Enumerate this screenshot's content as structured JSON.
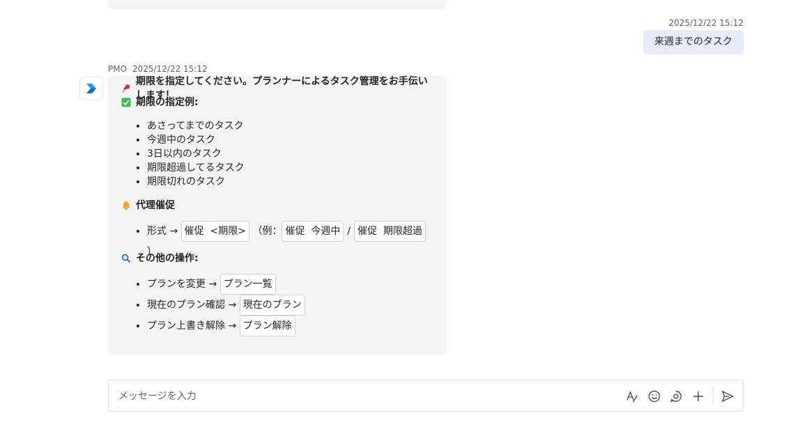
{
  "outgoing": {
    "timestamp": "2025/12/22 15:12",
    "text": "来週までのタスク"
  },
  "bot": {
    "sender": "PMO",
    "timestamp": "2025/12/22 15:12",
    "avatar_icon": "planner-logo-icon",
    "intro": "期限を指定してください。プランナーによるタスク管理をお手伝いします！",
    "intro_icon": "pushpin-icon",
    "examples_heading": "期限の指定例:",
    "examples_icon": "check-box-icon",
    "examples": [
      "あさってまでのタスク",
      "今週中のタスク",
      "3日以内のタスク",
      "期限超過してるタスク",
      "期限切れのタスク"
    ],
    "proxy_heading": "代理催促",
    "proxy_icon": "bell-icon",
    "proxy": {
      "lead": "形式 →",
      "format_chip": "催促  <期限>",
      "example_open": "（例：",
      "example_chip_1": "催促  今週中",
      "slash": "/",
      "example_chip_2": "催促  期限超過",
      "example_close": "）"
    },
    "other_heading": "その他の操作:",
    "other_icon": "magnifier-icon",
    "other": [
      {
        "lead": "プランを変更 →",
        "chip": "プラン一覧"
      },
      {
        "lead": "現在のプラン確認 →",
        "chip": "現在のプラン"
      },
      {
        "lead": "プラン上書き解除 →",
        "chip": "プラン解除"
      }
    ]
  },
  "compose": {
    "placeholder": "メッセージを入力",
    "tools": [
      "format-icon",
      "emoji-icon",
      "loop-icon",
      "plus-icon",
      "send-icon"
    ]
  },
  "colors": {
    "bot_bubble": "#f4f4f4",
    "user_bubble": "#e8ebfa",
    "chip_border": "#d1d1d1"
  }
}
